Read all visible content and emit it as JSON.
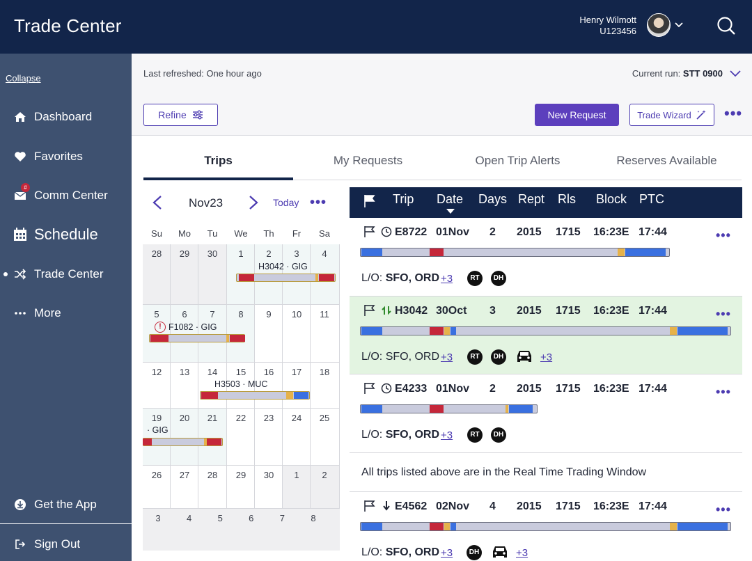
{
  "header": {
    "title": "Trade Center",
    "user_name": "Henry Wilmott",
    "user_id": "U123456"
  },
  "sidebar": {
    "collapse": "Collapse",
    "items": [
      {
        "label": "Dashboard",
        "icon": "home-icon"
      },
      {
        "label": "Favorites",
        "icon": "heart-icon"
      },
      {
        "label": "Comm Center",
        "icon": "mail-icon",
        "badge": "#"
      },
      {
        "label": "Schedule",
        "icon": "calendar-icon"
      },
      {
        "label": "Trade Center",
        "icon": "shuffle-icon",
        "active": true
      },
      {
        "label": "More",
        "icon": "ellipsis-icon"
      }
    ],
    "get_app": "Get the App",
    "sign_out": "Sign Out"
  },
  "topbar": {
    "last_refreshed": "Last refreshed: One hour ago",
    "current_run_label": "Current run: ",
    "current_run_value": "STT 0900",
    "refine": "Refine",
    "new_request": "New Request",
    "trade_wizard": "Trade Wizard"
  },
  "tabs": [
    "Trips",
    "My Requests",
    "Open Trip Alerts",
    "Reserves Available"
  ],
  "calendar": {
    "month": "Nov23",
    "today": "Today",
    "dow": [
      "Su",
      "Mo",
      "Tu",
      "We",
      "Th",
      "Fr",
      "Sa"
    ],
    "weeks": [
      [
        "28",
        "29",
        "30",
        "1",
        "2",
        "3",
        "4"
      ],
      [
        "5",
        "6",
        "7",
        "8",
        "9",
        "10",
        "11"
      ],
      [
        "12",
        "13",
        "14",
        "15",
        "16",
        "17",
        "18"
      ],
      [
        "19",
        "20",
        "21",
        "22",
        "23",
        "24",
        "25"
      ],
      [
        "26",
        "27",
        "28",
        "29",
        "30",
        "1",
        "2"
      ],
      [
        "3",
        "4",
        "5",
        "6",
        "7",
        "8"
      ]
    ],
    "trips": [
      {
        "label": "H3042 · GIG"
      },
      {
        "label": "F1082 · GIG"
      },
      {
        "label": "H3503 · MUC"
      },
      {
        "label": "· GIG"
      }
    ]
  },
  "table": {
    "headers": [
      "Trip",
      "Date",
      "Days",
      "Rept",
      "Rls",
      "Block",
      "PTC"
    ],
    "rows": [
      {
        "trip": "E8722",
        "date": "01Nov",
        "days": "2",
        "rept": "2015",
        "rls": "1715",
        "block": "16:23E",
        "ptc": "17:44",
        "status_icon": "clock-icon",
        "lo_prefix": "L/O: ",
        "lo": "SFO, ORD",
        "more": "+3",
        "pills": [
          "RT",
          "DH"
        ],
        "car_more": ""
      },
      {
        "trip": "H3042",
        "date": "30Oct",
        "days": "3",
        "rept": "2015",
        "rls": "1715",
        "block": "16:23E",
        "ptc": "17:44",
        "status_icon": "trade-icon",
        "lo_prefix": "L/O: ",
        "lo": "SFO, ORD",
        "more": "+3",
        "pills": [
          "RT",
          "DH"
        ],
        "car_more": "+3"
      },
      {
        "trip": "E4233",
        "date": "01Nov",
        "days": "2",
        "rept": "2015",
        "rls": "1715",
        "block": "16:23E",
        "ptc": "17:44",
        "status_icon": "clock-icon",
        "lo_prefix": "L/O: ",
        "lo": "SFO, ORD",
        "more": "+3",
        "pills": [
          "RT",
          "DH"
        ],
        "car_more": ""
      },
      {
        "trip": "E4562",
        "date": "02Nov",
        "days": "4",
        "rept": "2015",
        "rls": "1715",
        "block": "16:23E",
        "ptc": "17:44",
        "status_icon": "arrow-down-icon",
        "lo_prefix": "L/O: ",
        "lo": "SFO, ORD",
        "more": "+3",
        "pills": [
          "DH"
        ],
        "car_more": "+3"
      }
    ],
    "notice": "All trips listed above are in the Real Time Trading Window"
  },
  "colors": {
    "navy": "#12254a",
    "sidebar": "#3e5170",
    "accent": "#5c3fbd",
    "bar_blue": "#3a70e0",
    "bar_red": "#c5273a",
    "bar_gold": "#e6b24a",
    "bar_track": "#c9cbdd",
    "row_green": "#e3f4e1"
  }
}
